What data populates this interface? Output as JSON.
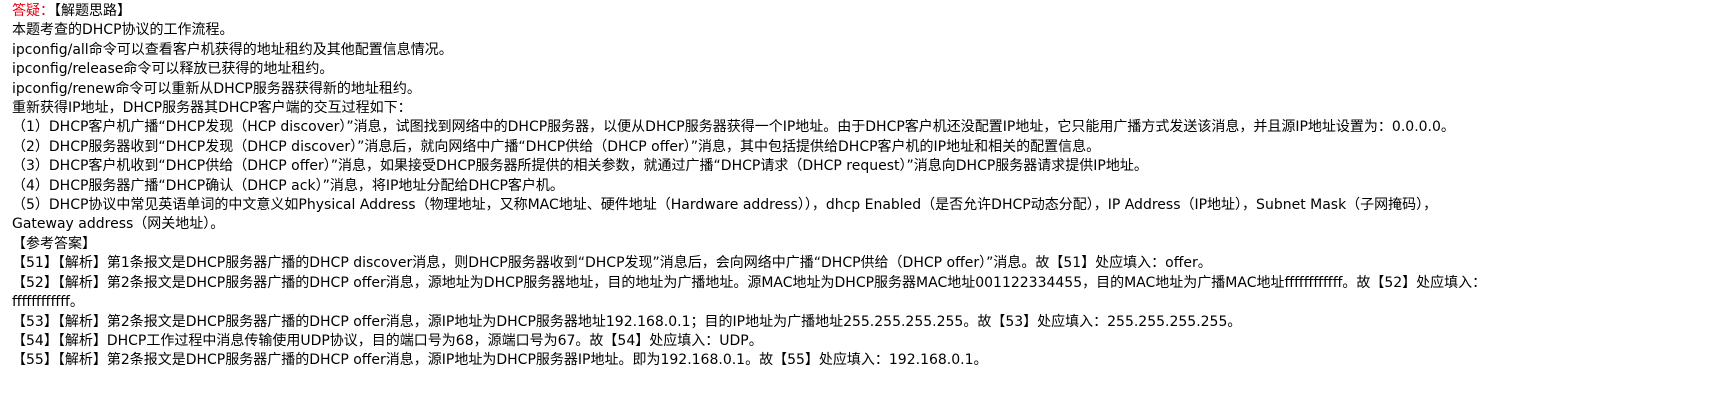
{
  "header": {
    "answer_label": "答疑：",
    "section_title": "【解题思路】"
  },
  "intro": [
    "本题考查的DHCP协议的工作流程。",
    "ipconfig/all命令可以查看客户机获得的地址租约及其他配置信息情况。",
    "ipconfig/release命令可以释放已获得的地址租约。",
    "ipconfig/renew命令可以重新从DHCP服务器获得新的地址租约。",
    "重新获得IP地址，DHCP服务器其DHCP客户端的交互过程如下："
  ],
  "steps": [
    "（1）DHCP客户机广播“DHCP发现（HCP discover）”消息，试图找到网络中的DHCP服务器，以便从DHCP服务器获得一个IP地址。由于DHCP客户机还没配置IP地址，它只能用广播方式发送该消息，并且源IP地址设置为：0.0.0.0。",
    "（2）DHCP服务器收到“DHCP发现（DHCP discover）”消息后，就向网络中广播“DHCP供给（DHCP offer）”消息，其中包括提供给DHCP客户机的IP地址和相关的配置信息。",
    "（3）DHCP客户机收到“DHCP供给（DHCP offer）”消息，如果接受DHCP服务器所提供的相关参数，就通过广播“DHCP请求（DHCP request）”消息向DHCP服务器请求提供IP地址。",
    "（4）DHCP服务器广播“DHCP确认（DHCP ack）”消息，将IP地址分配给DHCP客户机。",
    "（5）DHCP协议中常见英语单词的中文意义如Physical Address（物理地址，又称MAC地址、硬件地址（Hardware address）），dhcp Enabled（是否允许DHCP动态分配），IP Address（IP地址），Subnet Mask（子网掩码），",
    "Gateway address（网关地址）。"
  ],
  "reference_title": "【参考答案】",
  "answers": [
    "【51】【解析】第1条报文是DHCP服务器广播的DHCP discover消息，则DHCP服务器收到“DHCP发现”消息后，会向网络中广播“DHCP供给（DHCP offer）”消息。故【51】处应填入：offer。",
    "【52】【解析】第2条报文是DHCP服务器广播的DHCP offer消息，源地址为DHCP服务器地址，目的地址为广播地址。源MAC地址为DHCP服务器MAC地址001122334455，目的MAC地址为广播MAC地址ffffffffffff。故【52】处应填入：",
    "ffffffffffff。",
    "【53】【解析】第2条报文是DHCP服务器广播的DHCP offer消息，源IP地址为DHCP服务器地址192.168.0.1；目的IP地址为广播地址255.255.255.255。故【53】处应填入：255.255.255.255。",
    "【54】【解析】DHCP工作过程中消息传输使用UDP协议，目的端口号为68，源端口号为67。故【54】处应填入：UDP。",
    "【55】【解析】第2条报文是DHCP服务器广播的DHCP offer消息，源IP地址为DHCP服务器IP地址。即为192.168.0.1。故【55】处应填入：192.168.0.1。"
  ],
  "colors": {
    "answer_label": "#e60012",
    "text": "#000000"
  }
}
